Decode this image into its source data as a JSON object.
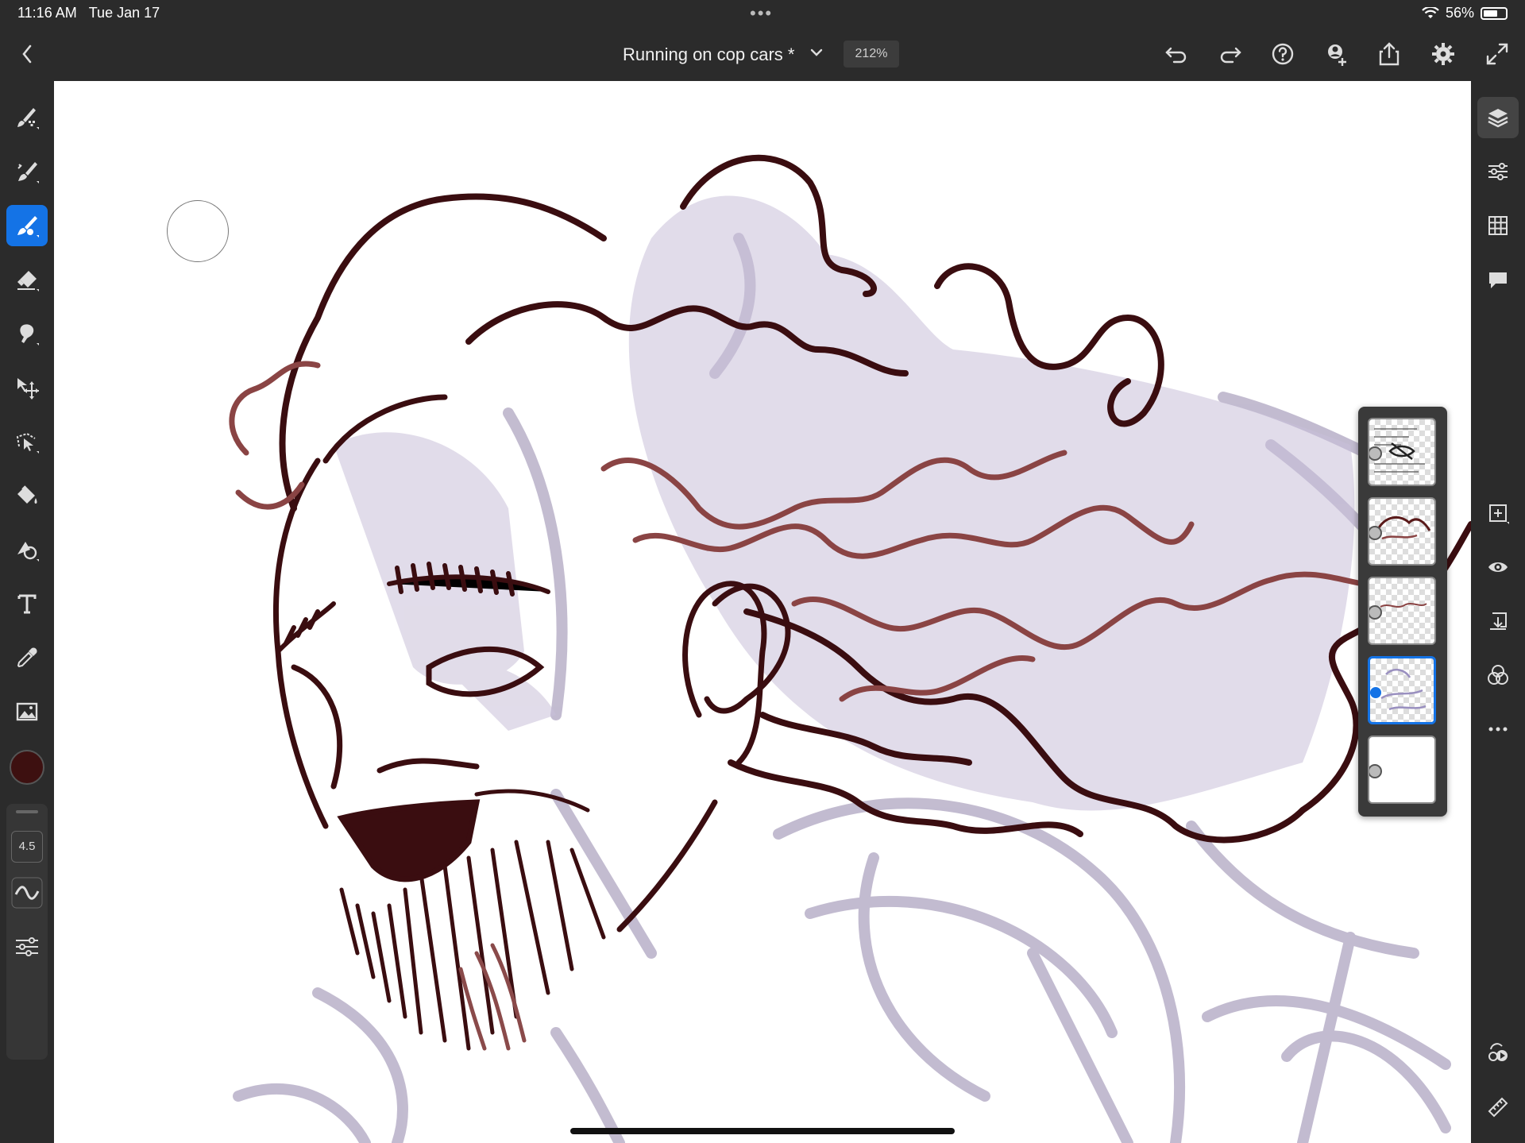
{
  "status_bar": {
    "time": "11:16 AM",
    "date": "Tue Jan 17",
    "battery": "56%"
  },
  "header": {
    "document_title": "Running on cop cars *",
    "zoom": "212%",
    "icons": [
      "chevron-left-icon",
      "chevron-down-icon",
      "undo-icon",
      "redo-icon",
      "help-icon",
      "invite-user-icon",
      "share-icon",
      "settings-icon",
      "fullscreen-icon"
    ]
  },
  "left_toolbar": {
    "tools": [
      "pixel-brush",
      "paint-brush",
      "live-brush",
      "eraser",
      "smudge",
      "move-transform",
      "lasso-select",
      "fill",
      "shape",
      "text",
      "eyedropper",
      "place-image"
    ],
    "active_tool": "live-brush",
    "brush_size": "4.5",
    "color": "#3d1010"
  },
  "right_toolbar": {
    "tools": [
      "layers",
      "layer-properties",
      "grid",
      "comments",
      "add-layer",
      "visibility",
      "merge-down",
      "blend-modes",
      "more-options",
      "timelapse",
      "ruler"
    ]
  },
  "layers": {
    "count": 5,
    "selected_index": 3
  }
}
